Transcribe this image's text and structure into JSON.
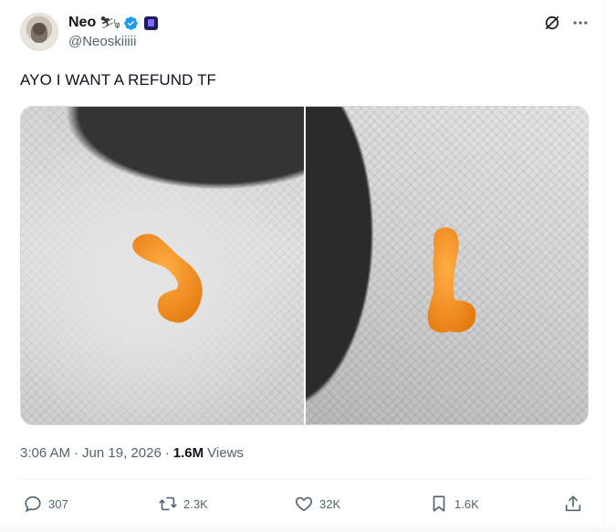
{
  "author": {
    "display_name": "Neo",
    "name_emoji": "⛷ₗ",
    "handle": "@Neoskiiiii",
    "verified": true
  },
  "post": {
    "text": "AYO I WANT A REFUND TF",
    "time": "3:06 AM",
    "separator": "·",
    "date": "Jun 19, 2026",
    "views_count": "1.6M",
    "views_label": "Views"
  },
  "actions": {
    "replies": "307",
    "reposts": "2.3K",
    "likes": "32K",
    "bookmarks": "1.6K"
  },
  "icons": [
    "grok-icon",
    "more-icon",
    "reply-icon",
    "repost-icon",
    "like-icon",
    "bookmark-icon",
    "share-icon",
    "verified-icon"
  ],
  "colors": {
    "text_primary": "#0f1419",
    "text_secondary": "#536471",
    "verified_blue": "#1d9bf0",
    "snack_orange": "#f08a1c"
  }
}
